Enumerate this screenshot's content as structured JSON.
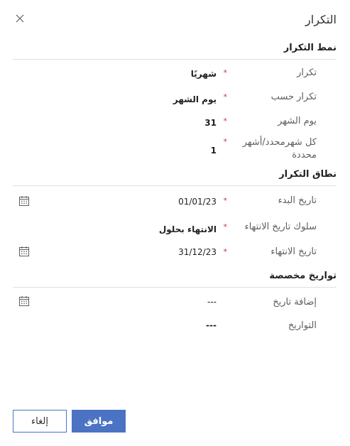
{
  "dialog": {
    "title": "التكرار"
  },
  "sections": {
    "pattern": "نمط التكرار",
    "range": "نطاق التكرار",
    "custom": "تواريخ مخصصة"
  },
  "fields": {
    "repeat": {
      "label": "تكرار",
      "value": "شهريًا"
    },
    "repeat_by": {
      "label": "تكرار حسب",
      "value": "يوم الشهر"
    },
    "day_of_month": {
      "label": "يوم الشهر",
      "value": "31"
    },
    "every_n_months": {
      "label": "كل شهرمحدد/أشهر محددة",
      "value": "1"
    },
    "start_date": {
      "label": "تاريخ البدء",
      "value": "01/01/23"
    },
    "end_behavior": {
      "label": "سلوك تاريخ الانتهاء",
      "value": "الانتهاء بحلول"
    },
    "end_date": {
      "label": "تاريخ الانتهاء",
      "value": "31/12/23"
    },
    "add_date": {
      "label": "إضافة تاريخ",
      "value": "---"
    },
    "dates": {
      "label": "التواريخ",
      "value": "---"
    }
  },
  "required_mark": "*",
  "buttons": {
    "ok": "موافق",
    "cancel": "إلغاء"
  },
  "icons": {
    "close": "close-icon",
    "calendar": "calendar-icon"
  },
  "colors": {
    "accent": "#4b73c3",
    "required": "#d13438",
    "divider": "#e1dfdd"
  }
}
